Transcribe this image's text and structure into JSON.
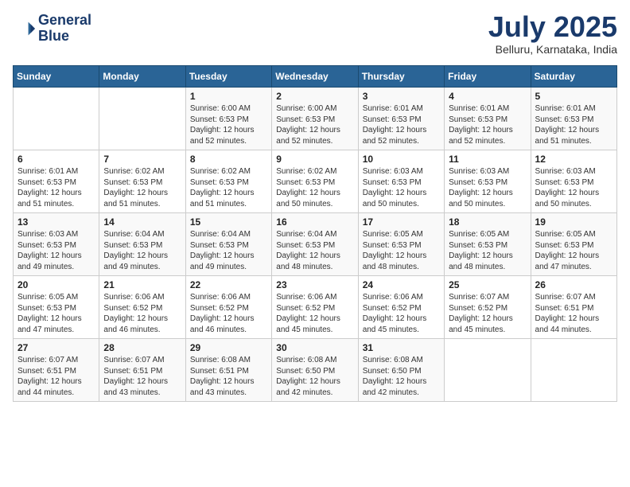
{
  "header": {
    "logo_line1": "General",
    "logo_line2": "Blue",
    "month": "July 2025",
    "location": "Belluru, Karnataka, India"
  },
  "weekdays": [
    "Sunday",
    "Monday",
    "Tuesday",
    "Wednesday",
    "Thursday",
    "Friday",
    "Saturday"
  ],
  "weeks": [
    [
      {
        "day": "",
        "info": ""
      },
      {
        "day": "",
        "info": ""
      },
      {
        "day": "1",
        "info": "Sunrise: 6:00 AM\nSunset: 6:53 PM\nDaylight: 12 hours and 52 minutes."
      },
      {
        "day": "2",
        "info": "Sunrise: 6:00 AM\nSunset: 6:53 PM\nDaylight: 12 hours and 52 minutes."
      },
      {
        "day": "3",
        "info": "Sunrise: 6:01 AM\nSunset: 6:53 PM\nDaylight: 12 hours and 52 minutes."
      },
      {
        "day": "4",
        "info": "Sunrise: 6:01 AM\nSunset: 6:53 PM\nDaylight: 12 hours and 52 minutes."
      },
      {
        "day": "5",
        "info": "Sunrise: 6:01 AM\nSunset: 6:53 PM\nDaylight: 12 hours and 51 minutes."
      }
    ],
    [
      {
        "day": "6",
        "info": "Sunrise: 6:01 AM\nSunset: 6:53 PM\nDaylight: 12 hours and 51 minutes."
      },
      {
        "day": "7",
        "info": "Sunrise: 6:02 AM\nSunset: 6:53 PM\nDaylight: 12 hours and 51 minutes."
      },
      {
        "day": "8",
        "info": "Sunrise: 6:02 AM\nSunset: 6:53 PM\nDaylight: 12 hours and 51 minutes."
      },
      {
        "day": "9",
        "info": "Sunrise: 6:02 AM\nSunset: 6:53 PM\nDaylight: 12 hours and 50 minutes."
      },
      {
        "day": "10",
        "info": "Sunrise: 6:03 AM\nSunset: 6:53 PM\nDaylight: 12 hours and 50 minutes."
      },
      {
        "day": "11",
        "info": "Sunrise: 6:03 AM\nSunset: 6:53 PM\nDaylight: 12 hours and 50 minutes."
      },
      {
        "day": "12",
        "info": "Sunrise: 6:03 AM\nSunset: 6:53 PM\nDaylight: 12 hours and 50 minutes."
      }
    ],
    [
      {
        "day": "13",
        "info": "Sunrise: 6:03 AM\nSunset: 6:53 PM\nDaylight: 12 hours and 49 minutes."
      },
      {
        "day": "14",
        "info": "Sunrise: 6:04 AM\nSunset: 6:53 PM\nDaylight: 12 hours and 49 minutes."
      },
      {
        "day": "15",
        "info": "Sunrise: 6:04 AM\nSunset: 6:53 PM\nDaylight: 12 hours and 49 minutes."
      },
      {
        "day": "16",
        "info": "Sunrise: 6:04 AM\nSunset: 6:53 PM\nDaylight: 12 hours and 48 minutes."
      },
      {
        "day": "17",
        "info": "Sunrise: 6:05 AM\nSunset: 6:53 PM\nDaylight: 12 hours and 48 minutes."
      },
      {
        "day": "18",
        "info": "Sunrise: 6:05 AM\nSunset: 6:53 PM\nDaylight: 12 hours and 48 minutes."
      },
      {
        "day": "19",
        "info": "Sunrise: 6:05 AM\nSunset: 6:53 PM\nDaylight: 12 hours and 47 minutes."
      }
    ],
    [
      {
        "day": "20",
        "info": "Sunrise: 6:05 AM\nSunset: 6:53 PM\nDaylight: 12 hours and 47 minutes."
      },
      {
        "day": "21",
        "info": "Sunrise: 6:06 AM\nSunset: 6:52 PM\nDaylight: 12 hours and 46 minutes."
      },
      {
        "day": "22",
        "info": "Sunrise: 6:06 AM\nSunset: 6:52 PM\nDaylight: 12 hours and 46 minutes."
      },
      {
        "day": "23",
        "info": "Sunrise: 6:06 AM\nSunset: 6:52 PM\nDaylight: 12 hours and 45 minutes."
      },
      {
        "day": "24",
        "info": "Sunrise: 6:06 AM\nSunset: 6:52 PM\nDaylight: 12 hours and 45 minutes."
      },
      {
        "day": "25",
        "info": "Sunrise: 6:07 AM\nSunset: 6:52 PM\nDaylight: 12 hours and 45 minutes."
      },
      {
        "day": "26",
        "info": "Sunrise: 6:07 AM\nSunset: 6:51 PM\nDaylight: 12 hours and 44 minutes."
      }
    ],
    [
      {
        "day": "27",
        "info": "Sunrise: 6:07 AM\nSunset: 6:51 PM\nDaylight: 12 hours and 44 minutes."
      },
      {
        "day": "28",
        "info": "Sunrise: 6:07 AM\nSunset: 6:51 PM\nDaylight: 12 hours and 43 minutes."
      },
      {
        "day": "29",
        "info": "Sunrise: 6:08 AM\nSunset: 6:51 PM\nDaylight: 12 hours and 43 minutes."
      },
      {
        "day": "30",
        "info": "Sunrise: 6:08 AM\nSunset: 6:50 PM\nDaylight: 12 hours and 42 minutes."
      },
      {
        "day": "31",
        "info": "Sunrise: 6:08 AM\nSunset: 6:50 PM\nDaylight: 12 hours and 42 minutes."
      },
      {
        "day": "",
        "info": ""
      },
      {
        "day": "",
        "info": ""
      }
    ]
  ]
}
